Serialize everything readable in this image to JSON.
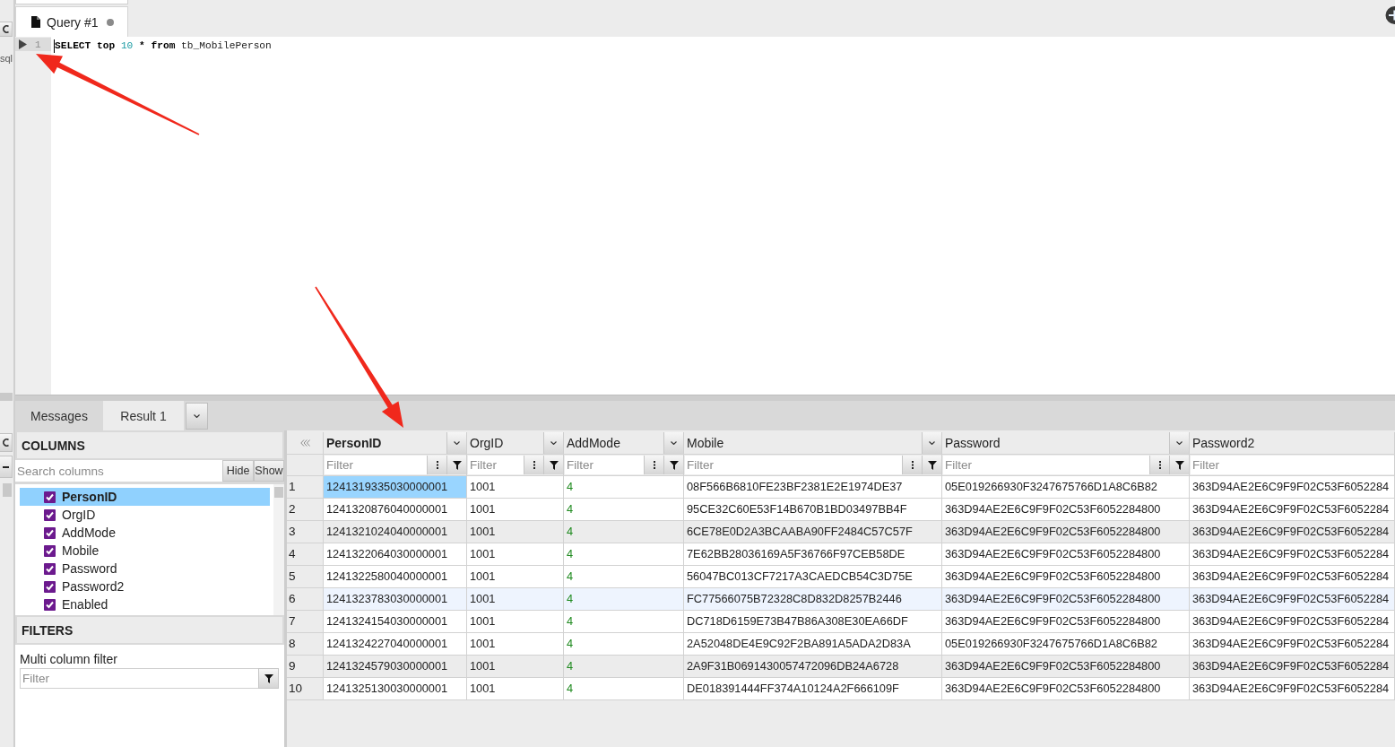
{
  "side_strip": {
    "label": "sql"
  },
  "editor_tabs": [
    {
      "label": "Query #1",
      "selected": true,
      "unsaved": true
    }
  ],
  "editor": {
    "lines": [
      {
        "number": "1",
        "tokens": [
          {
            "text": "SELECT",
            "kind": "keyword"
          },
          {
            "text": "top",
            "kind": "keyword"
          },
          {
            "text": "10",
            "kind": "number"
          },
          {
            "text": "*",
            "kind": "operator"
          },
          {
            "text": "from",
            "kind": "keyword"
          },
          {
            "text": "tb_MobilePerson",
            "kind": "identifier"
          }
        ]
      }
    ]
  },
  "result_tabs": [
    {
      "label": "Messages",
      "selected": false
    },
    {
      "label": "Result 1",
      "selected": true
    }
  ],
  "columns_panel": {
    "title": "COLUMNS",
    "search": {
      "placeholder": "Search columns"
    },
    "buttons": [
      "Hide",
      "Show"
    ],
    "items": [
      {
        "label": "PersonID",
        "checked": true,
        "selected": true
      },
      {
        "label": "OrgID",
        "checked": true,
        "selected": false
      },
      {
        "label": "AddMode",
        "checked": true,
        "selected": false
      },
      {
        "label": "Mobile",
        "checked": true,
        "selected": false
      },
      {
        "label": "Password",
        "checked": true,
        "selected": false
      },
      {
        "label": "Password2",
        "checked": true,
        "selected": false
      },
      {
        "label": "Enabled",
        "checked": true,
        "selected": false
      }
    ]
  },
  "filters_panel": {
    "title": "FILTERS",
    "label": "Multi column filter",
    "filter": {
      "placeholder": "Filter"
    }
  },
  "grid": {
    "columns": [
      {
        "name": "PersonID",
        "numeric": false,
        "primary_key": true,
        "has_menu": true,
        "filter_placeholder": "Filter"
      },
      {
        "name": "OrgID",
        "numeric": false,
        "primary_key": false,
        "has_menu": true,
        "filter_placeholder": "Filter"
      },
      {
        "name": "AddMode",
        "numeric": true,
        "primary_key": false,
        "has_menu": true,
        "filter_placeholder": "Filter"
      },
      {
        "name": "Mobile",
        "numeric": false,
        "primary_key": false,
        "has_menu": true,
        "filter_placeholder": "Filter"
      },
      {
        "name": "Password",
        "numeric": false,
        "primary_key": false,
        "has_menu": true,
        "filter_placeholder": "Filter"
      },
      {
        "name": "Password2",
        "numeric": false,
        "primary_key": false,
        "has_menu": false,
        "filter_placeholder": "Filter"
      }
    ],
    "rows": [
      {
        "number": "1",
        "striped": false,
        "hovered": false,
        "cells": [
          {
            "text": "1241319335030000001",
            "selected": true
          },
          {
            "text": "1001",
            "selected": false
          },
          {
            "text": "4",
            "selected": false
          },
          {
            "text": "08F566B6810FE23BF2381E2E1974DE37",
            "selected": false
          },
          {
            "text": "05E019266930F3247675766D1A8C6B82",
            "selected": false
          },
          {
            "text": "363D94AE2E6C9F9F02C53F6052284",
            "selected": false
          }
        ]
      },
      {
        "number": "2",
        "striped": false,
        "hovered": false,
        "cells": [
          {
            "text": "1241320876040000001",
            "selected": false
          },
          {
            "text": "1001",
            "selected": false
          },
          {
            "text": "4",
            "selected": false
          },
          {
            "text": "95CE32C60E53F14B670B1BD03497BB4F",
            "selected": false
          },
          {
            "text": "363D94AE2E6C9F9F02C53F6052284800",
            "selected": false
          },
          {
            "text": "363D94AE2E6C9F9F02C53F6052284",
            "selected": false
          }
        ]
      },
      {
        "number": "3",
        "striped": true,
        "hovered": false,
        "cells": [
          {
            "text": "1241321024040000001",
            "selected": false
          },
          {
            "text": "1001",
            "selected": false
          },
          {
            "text": "4",
            "selected": false
          },
          {
            "text": "6CE78E0D2A3BCAABA90FF2484C57C57F",
            "selected": false
          },
          {
            "text": "363D94AE2E6C9F9F02C53F6052284800",
            "selected": false
          },
          {
            "text": "363D94AE2E6C9F9F02C53F6052284",
            "selected": false
          }
        ]
      },
      {
        "number": "4",
        "striped": false,
        "hovered": false,
        "cells": [
          {
            "text": "1241322064030000001",
            "selected": false
          },
          {
            "text": "1001",
            "selected": false
          },
          {
            "text": "4",
            "selected": false
          },
          {
            "text": "7E62BB28036169A5F36766F97CEB58DE",
            "selected": false
          },
          {
            "text": "363D94AE2E6C9F9F02C53F6052284800",
            "selected": false
          },
          {
            "text": "363D94AE2E6C9F9F02C53F6052284",
            "selected": false
          }
        ]
      },
      {
        "number": "5",
        "striped": false,
        "hovered": false,
        "cells": [
          {
            "text": "1241322580040000001",
            "selected": false
          },
          {
            "text": "1001",
            "selected": false
          },
          {
            "text": "4",
            "selected": false
          },
          {
            "text": "56047BC013CF7217A3CAEDCB54C3D75E",
            "selected": false
          },
          {
            "text": "363D94AE2E6C9F9F02C53F6052284800",
            "selected": false
          },
          {
            "text": "363D94AE2E6C9F9F02C53F6052284",
            "selected": false
          }
        ]
      },
      {
        "number": "6",
        "striped": false,
        "hovered": true,
        "cells": [
          {
            "text": "1241323783030000001",
            "selected": false
          },
          {
            "text": "1001",
            "selected": false
          },
          {
            "text": "4",
            "selected": false
          },
          {
            "text": "FC77566075B72328C8D832D8257B2446",
            "selected": false
          },
          {
            "text": "363D94AE2E6C9F9F02C53F6052284800",
            "selected": false
          },
          {
            "text": "363D94AE2E6C9F9F02C53F6052284",
            "selected": false
          }
        ]
      },
      {
        "number": "7",
        "striped": false,
        "hovered": false,
        "cells": [
          {
            "text": "1241324154030000001",
            "selected": false
          },
          {
            "text": "1001",
            "selected": false
          },
          {
            "text": "4",
            "selected": false
          },
          {
            "text": "DC718D6159E73B47B86A308E30EA66DF",
            "selected": false
          },
          {
            "text": "363D94AE2E6C9F9F02C53F6052284800",
            "selected": false
          },
          {
            "text": "363D94AE2E6C9F9F02C53F6052284",
            "selected": false
          }
        ]
      },
      {
        "number": "8",
        "striped": false,
        "hovered": false,
        "cells": [
          {
            "text": "1241324227040000001",
            "selected": false
          },
          {
            "text": "1001",
            "selected": false
          },
          {
            "text": "4",
            "selected": false
          },
          {
            "text": "2A52048DE4E9C92F2BA891A5ADA2D83A",
            "selected": false
          },
          {
            "text": "05E019266930F3247675766D1A8C6B82",
            "selected": false
          },
          {
            "text": "363D94AE2E6C9F9F02C53F6052284",
            "selected": false
          }
        ]
      },
      {
        "number": "9",
        "striped": true,
        "hovered": false,
        "cells": [
          {
            "text": "1241324579030000001",
            "selected": false
          },
          {
            "text": "1001",
            "selected": false
          },
          {
            "text": "4",
            "selected": false
          },
          {
            "text": "2A9F31B0691430057472096DB24A6728",
            "selected": false
          },
          {
            "text": "363D94AE2E6C9F9F02C53F6052284800",
            "selected": false
          },
          {
            "text": "363D94AE2E6C9F9F02C53F6052284",
            "selected": false
          }
        ]
      },
      {
        "number": "10",
        "striped": false,
        "hovered": false,
        "cells": [
          {
            "text": "1241325130030000001",
            "selected": false
          },
          {
            "text": "1001",
            "selected": false
          },
          {
            "text": "4",
            "selected": false
          },
          {
            "text": "DE018391444FF374A10124A2F666109F",
            "selected": false
          },
          {
            "text": "363D94AE2E6C9F9F02C53F6052284800",
            "selected": false
          },
          {
            "text": "363D94AE2E6C9F9F02C53F6052284",
            "selected": false
          }
        ]
      }
    ]
  }
}
